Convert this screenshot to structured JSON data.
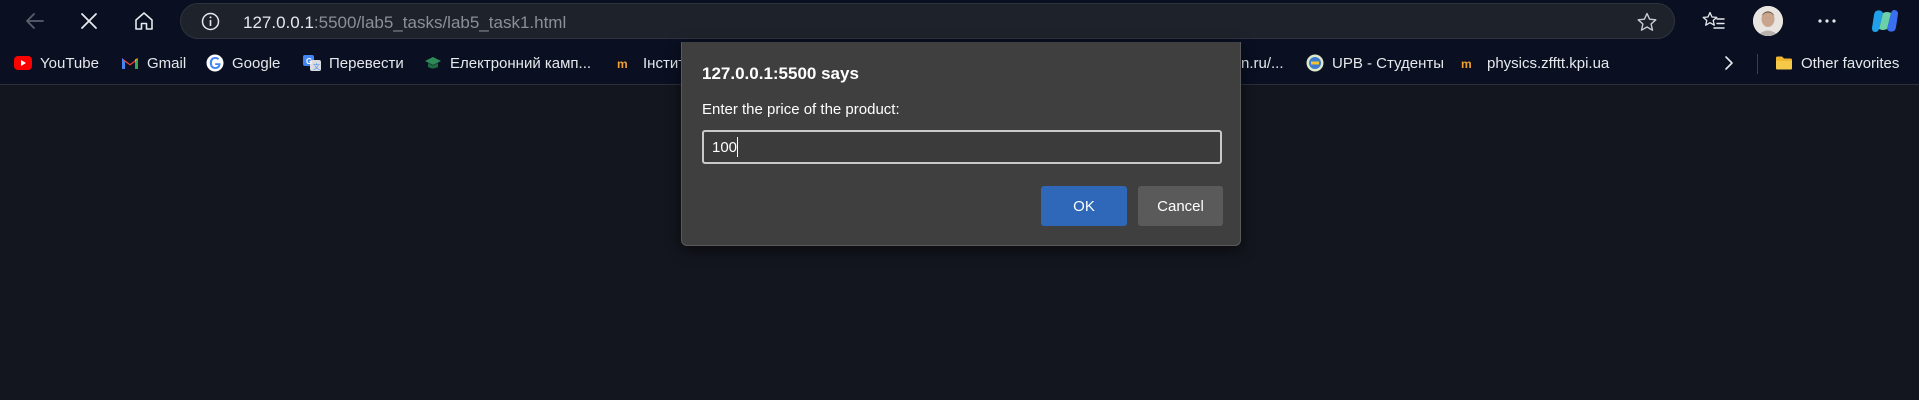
{
  "address_bar": {
    "url_host": "127.0.0.1",
    "url_rest": ":5500/lab5_tasks/lab5_task1.html"
  },
  "bookmarks": [
    {
      "label": "YouTube",
      "icon": "youtube-icon"
    },
    {
      "label": "Gmail",
      "icon": "gmail-icon"
    },
    {
      "label": "Google",
      "icon": "google-icon"
    },
    {
      "label": "Перевести",
      "icon": "translate-icon"
    },
    {
      "label": "Електронний камп...",
      "icon": "graduation-cap-icon"
    },
    {
      "label": "Інстит",
      "icon": "institute-icon"
    },
    {
      "label": "n.ru/...",
      "icon": "partial-bookmark"
    },
    {
      "label": "UPB - Студенты",
      "icon": "upb-icon"
    },
    {
      "label": "physics.zfftt.kpi.ua",
      "icon": "physics-icon"
    }
  ],
  "other_favorites": {
    "label": "Other favorites",
    "icon": "folder-icon"
  },
  "dialog": {
    "title": "127.0.0.1:5500 says",
    "message": "Enter the price of the product:",
    "input_value": "100",
    "ok_label": "OK",
    "cancel_label": "Cancel"
  },
  "colors": {
    "toolbar_bg": "#0a1022",
    "page_bg": "#13161e",
    "dialog_bg": "#3f3f3f",
    "ok_button": "#2f68b8",
    "cancel_button": "#5a5a5a"
  }
}
